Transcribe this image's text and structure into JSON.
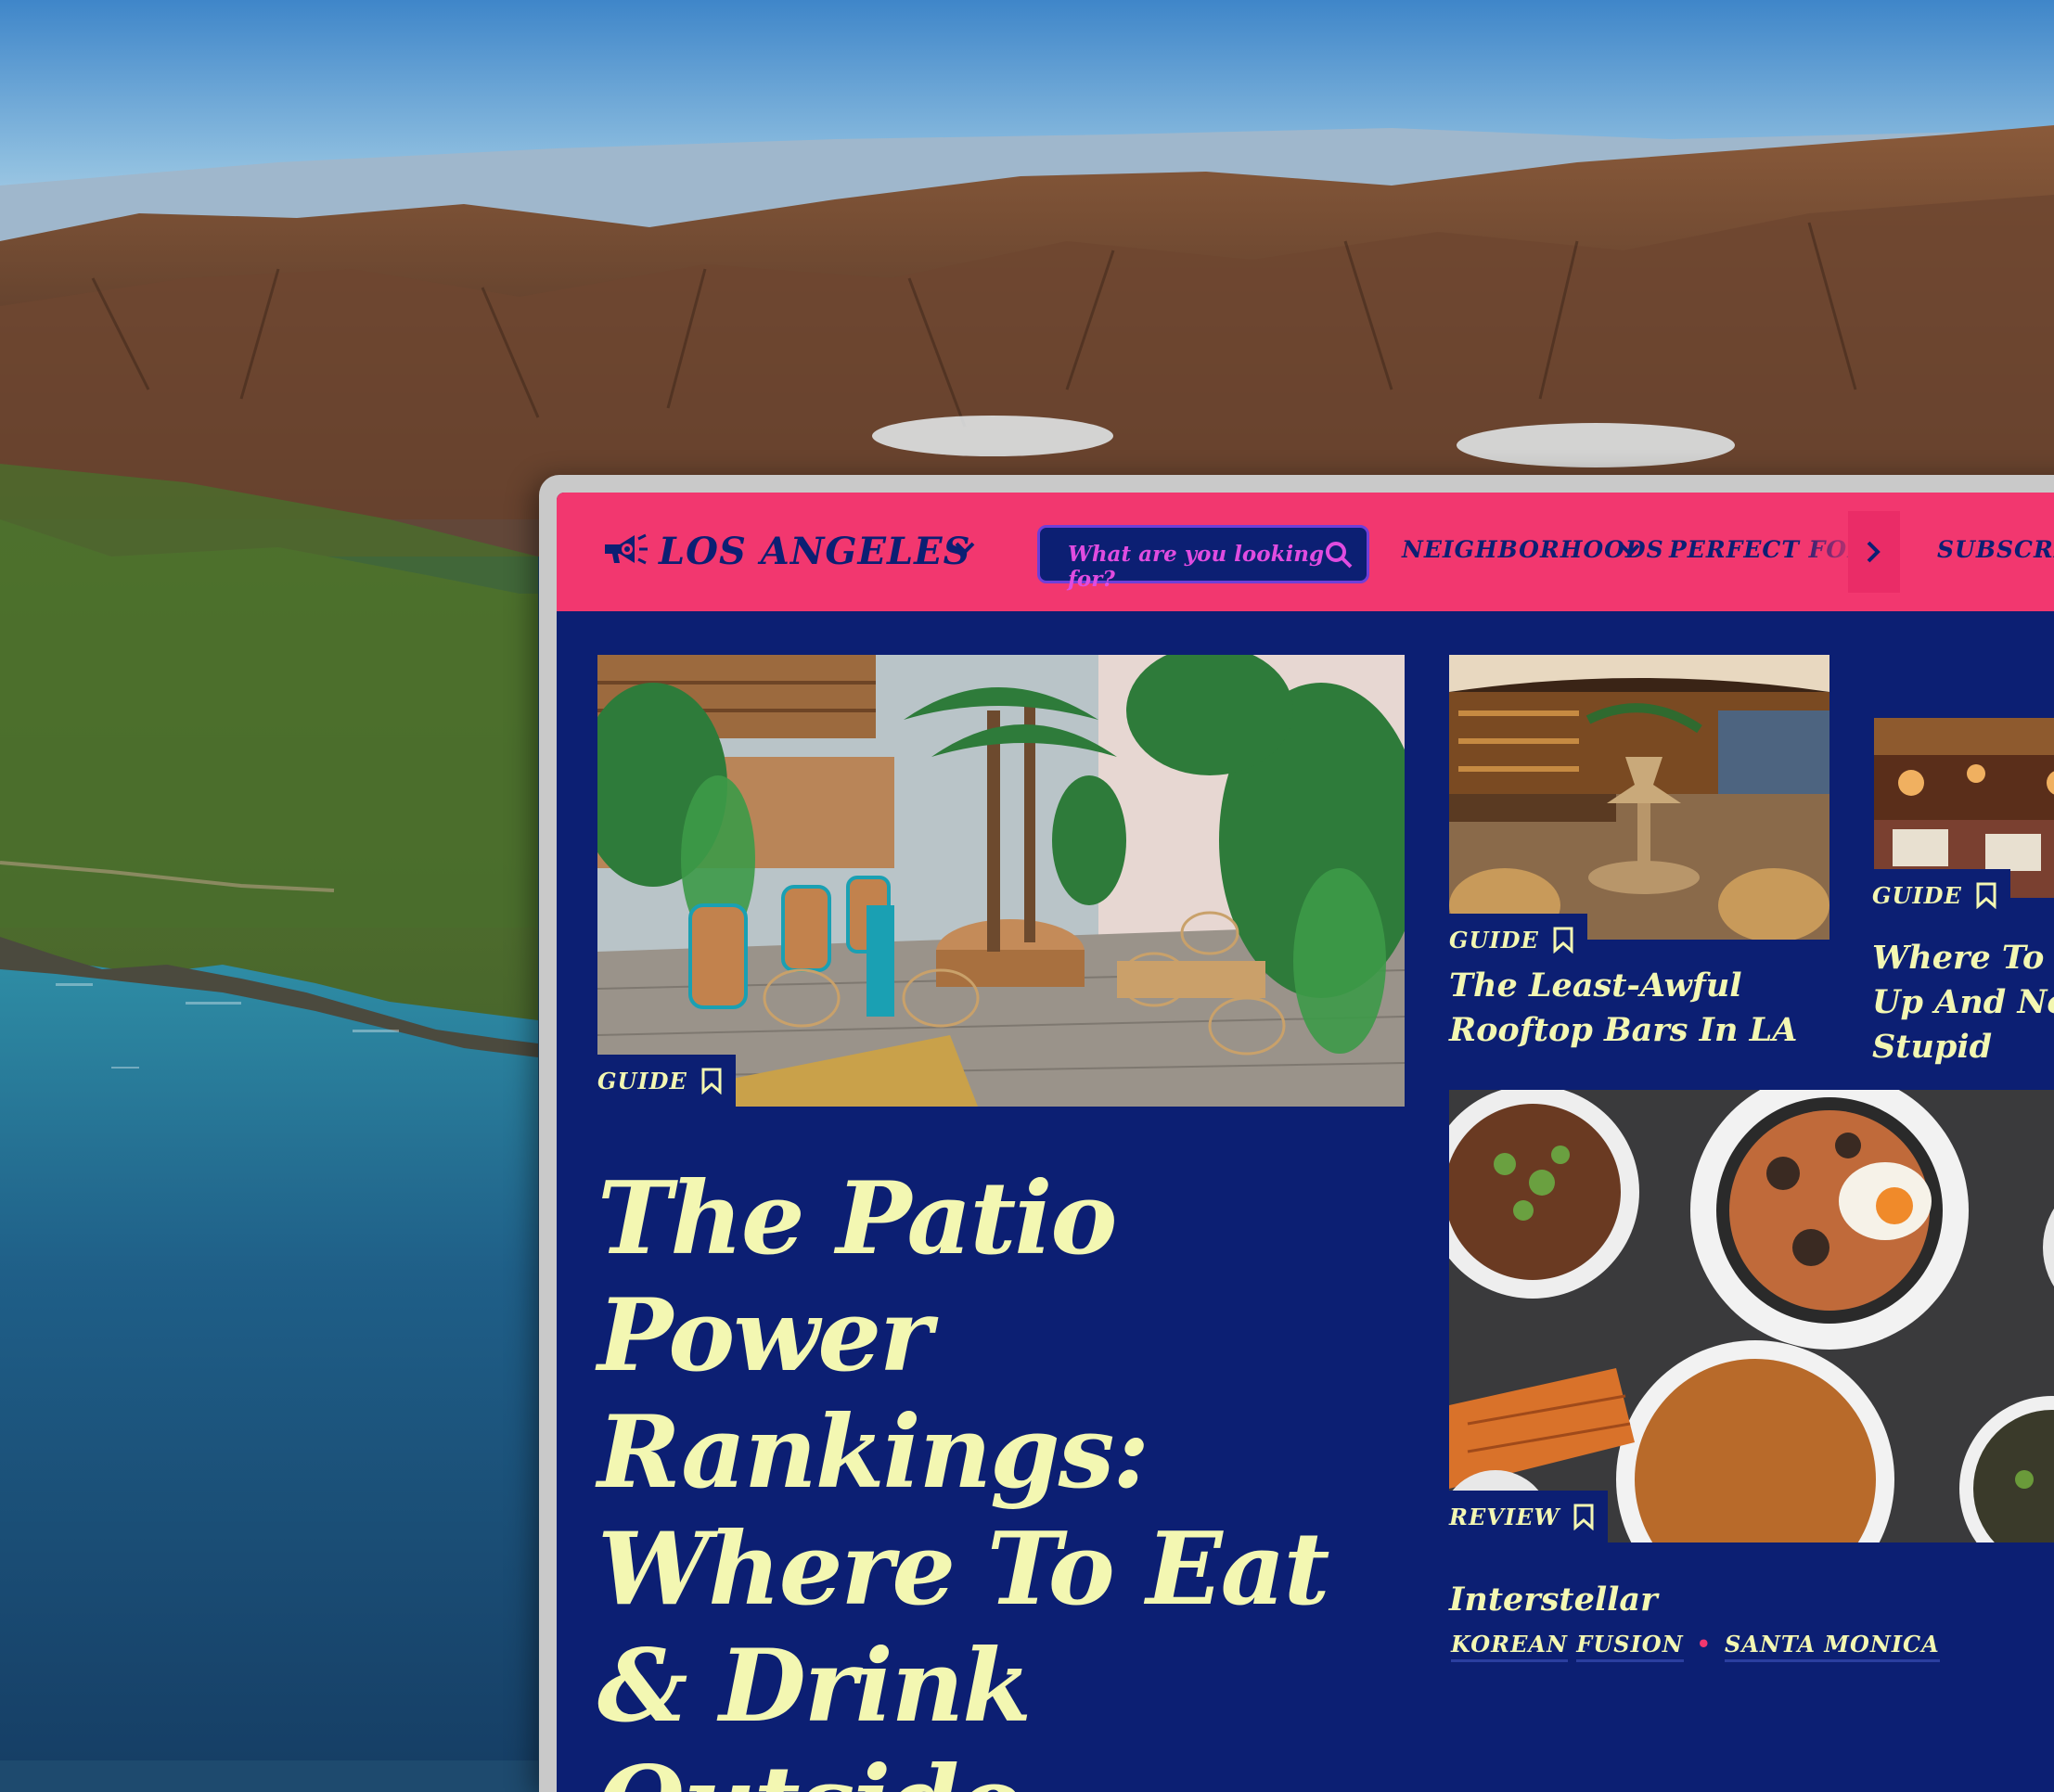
{
  "navbar": {
    "city": "LOS ANGELES",
    "search_placeholder": "What are you looking for?",
    "items": [
      "NEIGHBORHOODS",
      "PERFECT FORS",
      "SUBSCRIB"
    ]
  },
  "featured": {
    "tag": "GUIDE",
    "title": "The Patio Power Rankings: Where To Eat & Drink Outside"
  },
  "cards": [
    {
      "tag": "GUIDE",
      "title": "The Least-Awful Rooftop Bars In LA"
    },
    {
      "tag": "GUIDE",
      "title": "Where To Dr\nUp And Not l\nStupid"
    },
    {
      "tag": "REVIEW",
      "title": "Interstellar",
      "labels": [
        "KOREAN",
        "FUSION",
        "SANTA MONICA"
      ]
    }
  ],
  "colors": {
    "nav_pink": "#f2376f",
    "page_navy": "#0c1f73",
    "headline_cream": "#f3f7b2"
  }
}
